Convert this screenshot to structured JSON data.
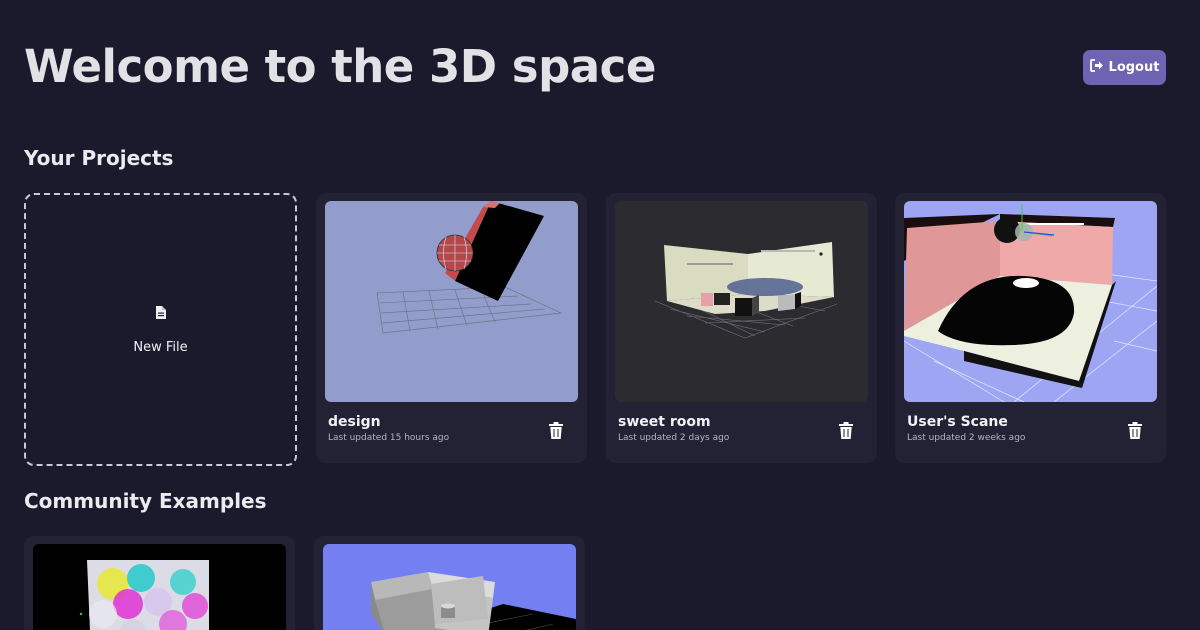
{
  "header": {
    "title": "Welcome to the 3D space",
    "logout_label": "Logout",
    "logout_icon": "sign-out-icon"
  },
  "projects_section": {
    "title": "Your Projects",
    "new_file": {
      "label": "New File",
      "icon": "file-icon"
    },
    "items": [
      {
        "name": "design",
        "updated": "Last updated 15 hours ago",
        "thumb_bg": "#929dcb"
      },
      {
        "name": "sweet room",
        "updated": "Last updated 2 days ago",
        "thumb_bg": "#2b2b30"
      },
      {
        "name": "User's Scane",
        "updated": "Last updated 2 weeks ago",
        "thumb_bg": "#9ea6f4"
      }
    ]
  },
  "community_section": {
    "title": "Community Examples",
    "items": [
      {
        "thumb_bg": "#000000"
      },
      {
        "thumb_bg": "#7480f2"
      }
    ]
  },
  "colors": {
    "background": "#1b1a2c",
    "card": "#232234",
    "accent": "#6f63b4"
  }
}
